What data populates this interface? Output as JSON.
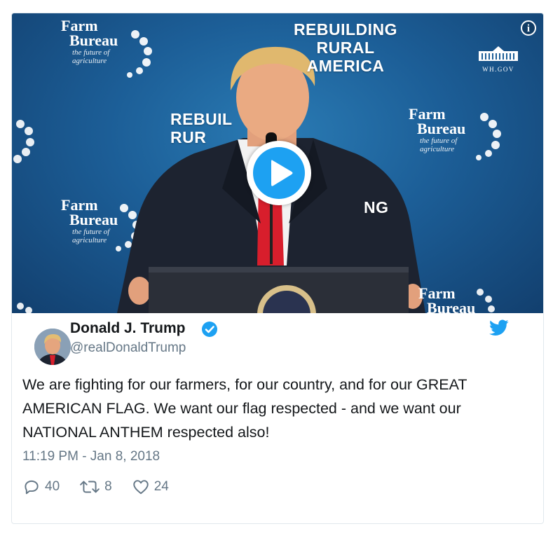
{
  "media": {
    "backdrop": {
      "headline_lines": [
        "REBUILDING",
        "RURAL",
        "AMERICA"
      ],
      "headline_repeat_lines": [
        "REBUIL",
        "RUR"
      ],
      "partial_text": "NG",
      "logo": {
        "line1": "Farm",
        "line2": "Bureau",
        "line3": "the future of",
        "line4": "agriculture"
      },
      "wh_logo_text": "WH.GOV"
    },
    "info_icon_label": "i",
    "colors": {
      "backdrop": "#1c5e97",
      "play": "#1da1f2",
      "tie": "#d81e2c"
    }
  },
  "tweet": {
    "author_name": "Donald J. Trump",
    "handle": "@realDonaldTrump",
    "text": "We are fighting for our farmers, for our country, and for our GREAT AMERICAN FLAG. We want our flag respected - and we want our NATIONAL ANTHEM respected also!",
    "timestamp": "11:19 PM - Jan 8, 2018",
    "replies": "40",
    "retweets": "8",
    "likes": "24",
    "icons": [
      "verified-icon",
      "twitter-bird-icon",
      "reply-icon",
      "retweet-icon",
      "like-icon"
    ],
    "colors": {
      "verified": "#1da1f2",
      "bird": "#1da1f2",
      "secondary_text": "#657786"
    }
  }
}
